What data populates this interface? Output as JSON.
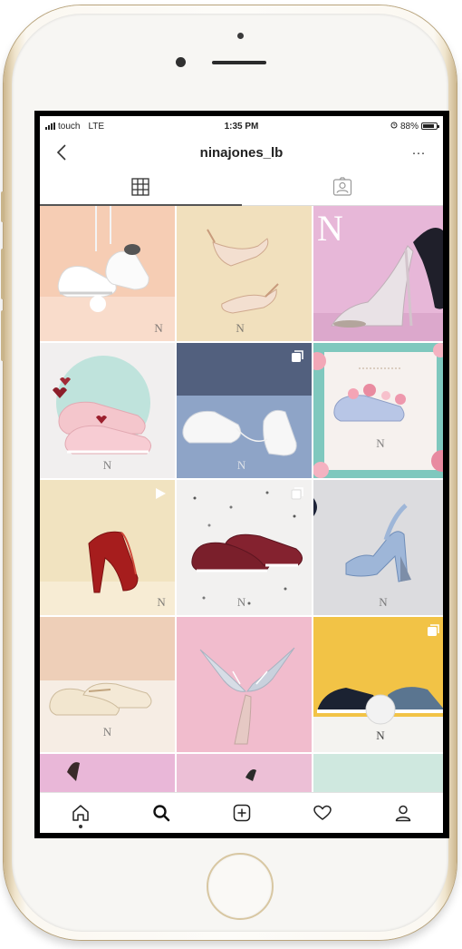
{
  "status_bar": {
    "carrier": "touch",
    "network": "LTE",
    "time": "1:35 PM",
    "battery": "88%",
    "battery_level": 0.88
  },
  "header": {
    "username": "ninajones_lb",
    "back_icon": "chevron-left-icon",
    "more_icon": "more-horizontal-icon",
    "more_label": "···"
  },
  "tabs": [
    {
      "name": "grid",
      "icon": "grid-icon",
      "active": true
    },
    {
      "name": "tagged",
      "icon": "tagged-photos-icon",
      "active": false
    }
  ],
  "grid": {
    "watermark": "N",
    "posts": [
      {
        "subject": "white sneakers hanging on peach",
        "badge": ""
      },
      {
        "subject": "nude heels on pale yellow",
        "badge": ""
      },
      {
        "subject": "clear heels and black heel on pink",
        "badge": ""
      },
      {
        "subject": "pink sneakers with hearts",
        "badge": ""
      },
      {
        "subject": "white sneakers on blue",
        "badge": "carousel"
      },
      {
        "subject": "floral framed sneaker",
        "badge": ""
      },
      {
        "subject": "red mule heel",
        "badge": "video"
      },
      {
        "subject": "burgundy sneakers",
        "badge": "carousel"
      },
      {
        "subject": "blue platform sandal",
        "badge": ""
      },
      {
        "subject": "cream sneakers on peach",
        "badge": ""
      },
      {
        "subject": "heels on pink",
        "badge": ""
      },
      {
        "subject": "slip-on sneakers on yellow",
        "badge": "carousel"
      },
      {
        "subject": "pink partial tile",
        "badge": ""
      },
      {
        "subject": "pink partial tile",
        "badge": ""
      },
      {
        "subject": "mint partial tile",
        "badge": ""
      }
    ]
  },
  "bottom_nav": [
    {
      "name": "home",
      "icon": "home-icon"
    },
    {
      "name": "search",
      "icon": "search-icon"
    },
    {
      "name": "new-post",
      "icon": "add-post-icon"
    },
    {
      "name": "activity",
      "icon": "heart-icon"
    },
    {
      "name": "profile",
      "icon": "profile-icon"
    }
  ],
  "colors": {
    "peach": "#f6cdb4",
    "pale_yellow": "#f1e0bd",
    "pink": "#e7b7d8",
    "blue": "#7f94b8",
    "cream": "#f2e3c5",
    "mustard": "#f2c346",
    "mint": "#cfe8df"
  }
}
